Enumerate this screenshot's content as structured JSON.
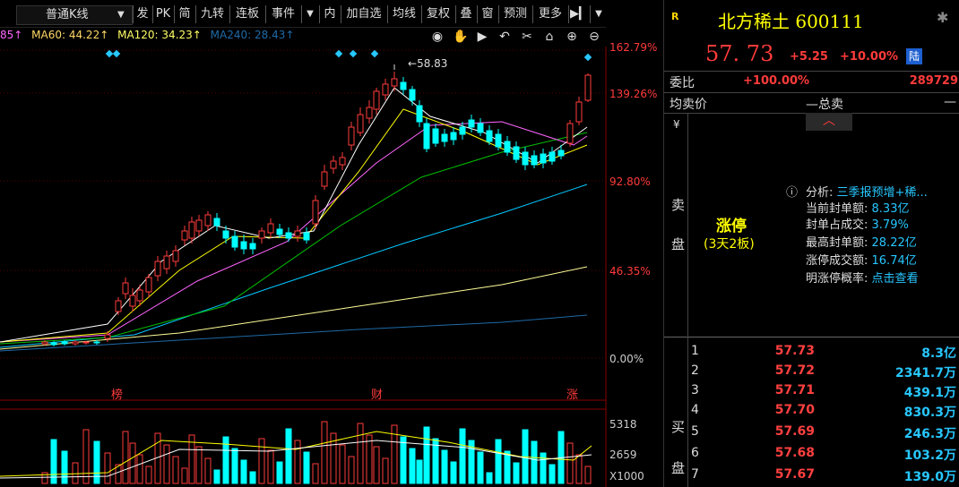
{
  "toolbar": {
    "kline_type": "普通K线",
    "items": [
      "发",
      "PK",
      "简",
      "九转",
      "连板",
      "事件",
      "内",
      "加自选",
      "均线",
      "复权",
      "叠",
      "窗",
      "预测",
      "更多"
    ]
  },
  "ma_bar": {
    "ma_prefix": "85↑",
    "ma60": "MA60: 44.22↑",
    "ma120": "MA120: 34.23↑",
    "ma240": "MA240: 28.43↑"
  },
  "price_axis": [
    "162.79%",
    "139.26%",
    "92.80%",
    "46.35%",
    "0.00%"
  ],
  "high_label": "58.83",
  "event_markers": [
    "榜",
    "财",
    "涨"
  ],
  "volume_axis": [
    "5318",
    "2659",
    "X1000"
  ],
  "stock": {
    "badge": "R",
    "name": "北方稀土 600111",
    "price": "57. 73",
    "change": "+5.25",
    "change_pct": "+10.00%",
    "exchange": "陆"
  },
  "weibi": {
    "label": "委比",
    "pct": "+100.00%",
    "value": "289729"
  },
  "ask": {
    "avg_label": "均卖价",
    "total_label": "—总卖",
    "dash": "—",
    "yen": "¥",
    "side_top": "卖",
    "side_bottom": "盘",
    "limit_up": "涨停",
    "limit_sub": "(3天2板)"
  },
  "analysis": {
    "title_label": "分析: ",
    "title_value": "三季报预增+稀...",
    "lines": [
      {
        "label": "当前封单额: ",
        "value": "8.33亿"
      },
      {
        "label": "封单占成交: ",
        "value": "3.79%"
      },
      {
        "label": "最高封单额: ",
        "value": "28.22亿"
      },
      {
        "label": "涨停成交额: ",
        "value": "16.74亿"
      },
      {
        "label": "明涨停概率: ",
        "value": "点击查看"
      }
    ]
  },
  "bid": {
    "side_top": "买",
    "side_bottom": "盘",
    "rows": [
      {
        "level": "1",
        "price": "57.73",
        "vol": "8.3亿"
      },
      {
        "level": "2",
        "price": "57.72",
        "vol": "2341.7万"
      },
      {
        "level": "3",
        "price": "57.71",
        "vol": "439.1万"
      },
      {
        "level": "4",
        "price": "57.70",
        "vol": "830.3万"
      },
      {
        "level": "5",
        "price": "57.69",
        "vol": "246.3万"
      },
      {
        "level": "6",
        "price": "57.68",
        "vol": "103.2万"
      },
      {
        "level": "7",
        "price": "57.67",
        "vol": "139.0万"
      }
    ]
  },
  "colors": {
    "up": "#ff3b3b",
    "down": "#00ffff",
    "blue": "#27c7ff",
    "yellow": "#ffff00"
  }
}
